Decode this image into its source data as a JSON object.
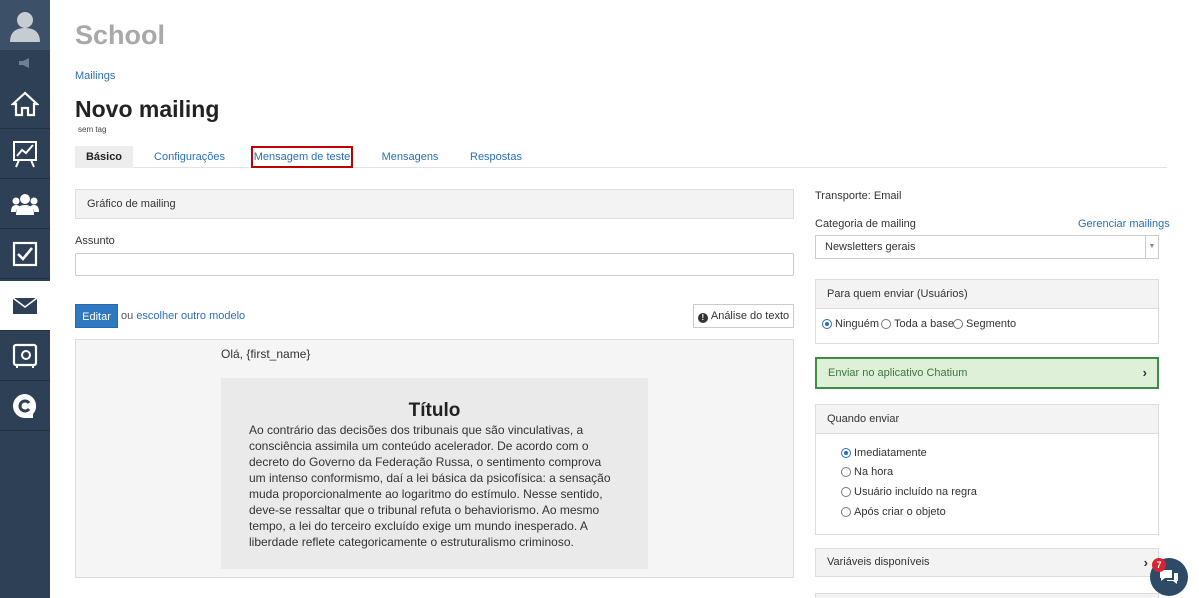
{
  "app": {
    "title": "School"
  },
  "breadcrumb": {
    "label": "Mailings"
  },
  "page": {
    "title": "Novo mailing",
    "tag": "sem tag"
  },
  "tabs": [
    {
      "label": "Básico"
    },
    {
      "label": "Configurações"
    },
    {
      "label": "Mensagem de teste"
    },
    {
      "label": "Mensagens"
    },
    {
      "label": "Respostas"
    }
  ],
  "editor": {
    "panel_title": "Gráfico de mailing",
    "subject_label": "Assunto",
    "subject_value": "",
    "edit_button": "Editar",
    "or_text": "ou",
    "choose_template_link": "escolher outro modelo",
    "analysis_button": "Análise do texto"
  },
  "preview": {
    "greeting": "Olá, {first_name}",
    "title": "Título",
    "body": "Ao contrário das decisões dos tribunais que são vinculativas, a consciência assimila um conteúdo acelerador. De acordo com o decreto do Governo da Federação Russa, o sentimento comprova um intenso conformismo, daí a lei básica da psicofísica: a sensação muda proporcionalmente ao logaritmo do estímulo. Nesse sentido, deve-se ressaltar que o tribunal refuta o behaviorismo. Ao mesmo tempo, a lei do terceiro excluído exige um mundo inesperado. A liberdade reflete categoricamente o estruturalismo criminoso."
  },
  "settings": {
    "transport": "Transporte: Email",
    "category_label": "Categoria de mailing",
    "manage_link": "Gerenciar mailings",
    "category_value": "Newsletters gerais",
    "recipients_title": "Para quem enviar (Usuários)",
    "recipients_options": [
      "Ninguém",
      "Toda a base",
      "Segmento"
    ],
    "recipients_selected": "Ninguém",
    "app_button": "Enviar no aplicativo Chatium",
    "when_title": "Quando enviar",
    "when_options": [
      "Imediatamente",
      "Na hora",
      "Usuário incluído na regra",
      "Após criar o objeto"
    ],
    "when_selected": "Imediatamente",
    "variables_title": "Variáveis disponíveis"
  },
  "chat": {
    "badge": "7"
  },
  "colors": {
    "accent": "#2a6ebb",
    "sidebar": "#2d4056",
    "highlight": "#c00000",
    "success_bg": "#dff0d8"
  }
}
